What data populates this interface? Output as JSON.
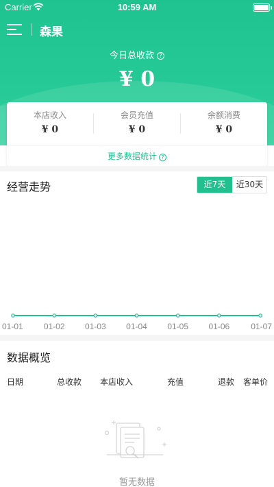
{
  "status_bar": {
    "carrier": "Carrier",
    "time": "10:59 AM"
  },
  "navbar": {
    "store_name": "森果"
  },
  "today": {
    "label": "今日总收款",
    "amount": "¥ 0"
  },
  "summary": {
    "stats": [
      {
        "label": "本店收入",
        "value": "¥ 0"
      },
      {
        "label": "会员充值",
        "value": "¥ 0"
      },
      {
        "label": "余额消费",
        "value": "¥ 0"
      }
    ],
    "more_label": "更多数据统计"
  },
  "trend": {
    "title": "经营走势",
    "range_options": [
      "近7天",
      "近30天"
    ],
    "selected_range": "近7天"
  },
  "chart_data": {
    "type": "line",
    "categories": [
      "01-01",
      "01-02",
      "01-03",
      "01-04",
      "01-05",
      "01-06",
      "01-07"
    ],
    "series": [
      {
        "values": [
          0,
          0,
          0,
          0,
          0,
          0,
          0
        ]
      }
    ],
    "title": "",
    "xlabel": "",
    "ylabel": "",
    "grid": false,
    "color": "#22c08f"
  },
  "overview": {
    "title": "数据概览",
    "columns": [
      "日期",
      "总收款",
      "本店收入",
      "充值",
      "退款",
      "客单价"
    ],
    "rows": [],
    "empty_text": "暂无数据"
  },
  "colors": {
    "accent": "#22c08f",
    "header_start": "#1fc38f",
    "header_end": "#2fd09c"
  }
}
